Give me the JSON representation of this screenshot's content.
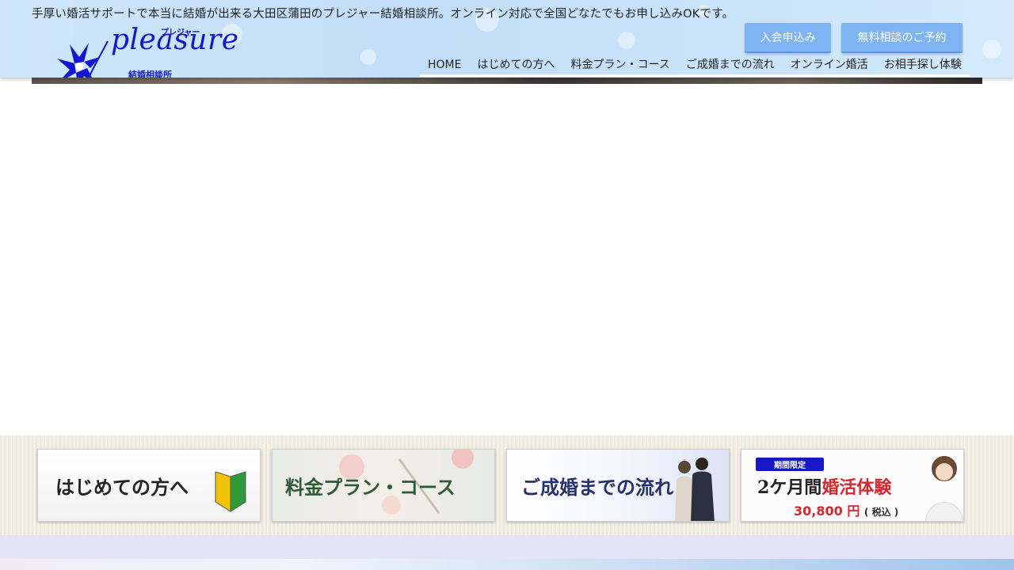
{
  "header": {
    "tagline": "手厚い婚活サポートで本当に結婚が出来る大田区蒲田のプレジャー結婚相談所。オンライン対応で全国どなたでもお申し込みOKです。",
    "logo": {
      "script": "pleasure",
      "kana": "プレジャー",
      "subtitle": "結婚相談所",
      "color": "#1414d6"
    },
    "buttons": {
      "join": "入会申込み",
      "consult": "無料相談のご予約"
    },
    "nav": [
      {
        "label": "HOME"
      },
      {
        "label": "はじめての方へ"
      },
      {
        "label": "料金プラン・コース"
      },
      {
        "label": "ご成婚までの流れ"
      },
      {
        "label": "オンライン婚活"
      },
      {
        "label": "お相手探し体験"
      }
    ]
  },
  "banners": {
    "first_time": {
      "label": "はじめての方へ",
      "icon": "beginner-mark-icon"
    },
    "pricing": {
      "label": "料金プラン・コース"
    },
    "flow": {
      "label": "ご成婚までの流れ"
    },
    "trial": {
      "badge": "期間限定",
      "prefix": "2ケ月間",
      "highlight": "婚活体験",
      "price": "30,800 円",
      "tax": "( 税込 )"
    }
  },
  "colors": {
    "accent_button": "#7fb4f4",
    "brand_blue": "#1414d6",
    "price_red": "#d8262e"
  }
}
